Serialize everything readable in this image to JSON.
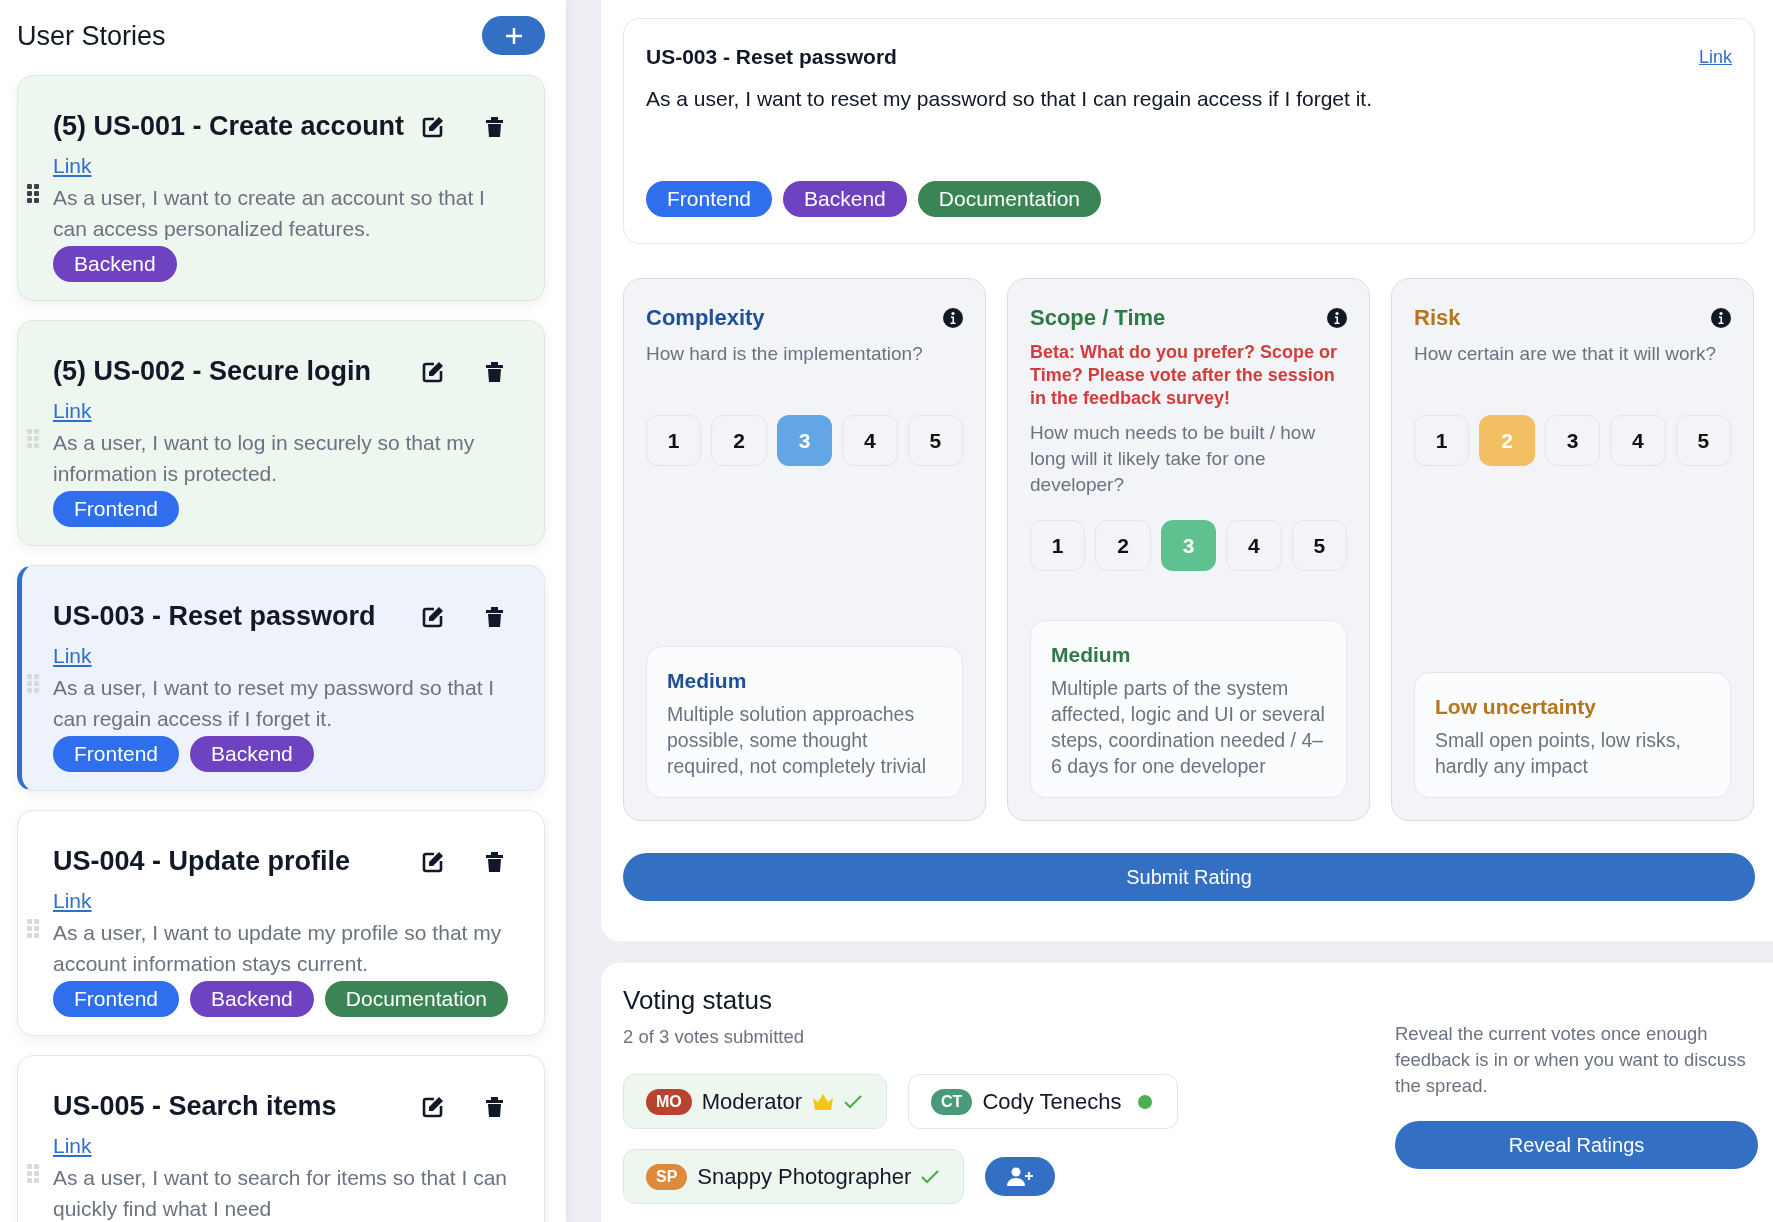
{
  "sidebar": {
    "title": "User Stories",
    "stories": [
      {
        "title": "(5) US-001 - Create account",
        "link": "Link",
        "description": "As a user, I want to create an account so that I can access personalized features.",
        "voted": true,
        "selected": false,
        "hovered": true,
        "tags": [
          {
            "label": "Backend",
            "color": "#6f42c1"
          }
        ]
      },
      {
        "title": "(5) US-002 - Secure login",
        "link": "Link",
        "description": "As a user, I want to log in securely so that my information is protected.",
        "voted": true,
        "selected": false,
        "hovered": false,
        "tags": [
          {
            "label": "Frontend",
            "color": "#2f6fed"
          }
        ]
      },
      {
        "title": "US-003 - Reset password",
        "link": "Link",
        "description": "As a user, I want to reset my password so that I can regain access if I forget it.",
        "voted": false,
        "selected": true,
        "hovered": false,
        "tags": [
          {
            "label": "Frontend",
            "color": "#2f6fed"
          },
          {
            "label": "Backend",
            "color": "#6f42c1"
          }
        ]
      },
      {
        "title": "US-004 - Update profile",
        "link": "Link",
        "description": "As a user, I want to update my profile so that my account information stays current.",
        "voted": false,
        "selected": false,
        "hovered": false,
        "tags": [
          {
            "label": "Frontend",
            "color": "#2f6fed"
          },
          {
            "label": "Backend",
            "color": "#6f42c1"
          },
          {
            "label": "Documentation",
            "color": "#3a8455"
          }
        ]
      },
      {
        "title": "US-005 - Search items",
        "link": "Link",
        "description": "As a user, I want to search for items so that I can quickly find what I need",
        "voted": false,
        "selected": false,
        "hovered": false
      }
    ]
  },
  "story": {
    "title": "US-003 - Reset password",
    "link": "Link",
    "description": "As a user, I want to reset my password so that I can regain access if I forget it.",
    "tags": [
      {
        "label": "Frontend",
        "color": "#2f6fed"
      },
      {
        "label": "Backend",
        "color": "#6f42c1"
      },
      {
        "label": "Documentation",
        "color": "#3a8455"
      }
    ]
  },
  "ratings": [
    {
      "title": "Complexity",
      "color": "#1f4f96",
      "highlight": {
        "color": "#63a6e6"
      },
      "question": "How hard is the implementation?",
      "options": [
        {
          "label": "1",
          "selected": false
        },
        {
          "label": "2",
          "selected": false
        },
        {
          "label": "3",
          "selected": true
        },
        {
          "label": "4",
          "selected": false
        },
        {
          "label": "5",
          "selected": false
        }
      ],
      "result": {
        "title": "Medium",
        "description": "Multiple solution approaches possible, some thought required, not completely trivial"
      }
    },
    {
      "title": "Scope / Time",
      "color": "#2e7a47",
      "highlight": {
        "color": "#5fc18f"
      },
      "notice": "Beta: What do you prefer? Scope or Time? Please vote after the session in the feedback survey!",
      "question": "How much needs to be built / how long will it likely take for one developer?",
      "options": [
        {
          "label": "1",
          "selected": false
        },
        {
          "label": "2",
          "selected": false
        },
        {
          "label": "3",
          "selected": true
        },
        {
          "label": "4",
          "selected": false
        },
        {
          "label": "5",
          "selected": false
        }
      ],
      "result": {
        "title": "Medium",
        "description": "Multiple parts of the system affected, logic and UI or several steps, coordination needed / 4–6 days for one developer"
      }
    },
    {
      "title": "Risk",
      "color": "#b3761e",
      "highlight": {
        "color": "#f2c063"
      },
      "question": "How certain are we that it will work?",
      "options": [
        {
          "label": "1",
          "selected": false
        },
        {
          "label": "2",
          "selected": true
        },
        {
          "label": "3",
          "selected": false
        },
        {
          "label": "4",
          "selected": false
        },
        {
          "label": "5",
          "selected": false
        }
      ],
      "result": {
        "title": "Low uncertainty",
        "description": "Small open points, low risks, hardly any impact"
      }
    }
  ],
  "submit_button": "Submit Rating",
  "voting": {
    "title": "Voting status",
    "summary": "2 of 3 votes submitted",
    "participants": [
      {
        "initials": "MO",
        "name": "Moderator",
        "color": "#b8432f",
        "voted": true,
        "moderator": true,
        "online": false
      },
      {
        "initials": "CT",
        "name": "Cody Tenechs",
        "color": "#4a9a7a",
        "voted": false,
        "moderator": false,
        "online": true
      },
      {
        "initials": "SP",
        "name": "Snappy Photographer",
        "color": "#dd8a3c",
        "voted": true,
        "moderator": false,
        "online": false
      }
    ],
    "hint": "Reveal the current votes once enough feedback is in or when you want to discuss the spread.",
    "reveal_button": "Reveal Ratings"
  }
}
